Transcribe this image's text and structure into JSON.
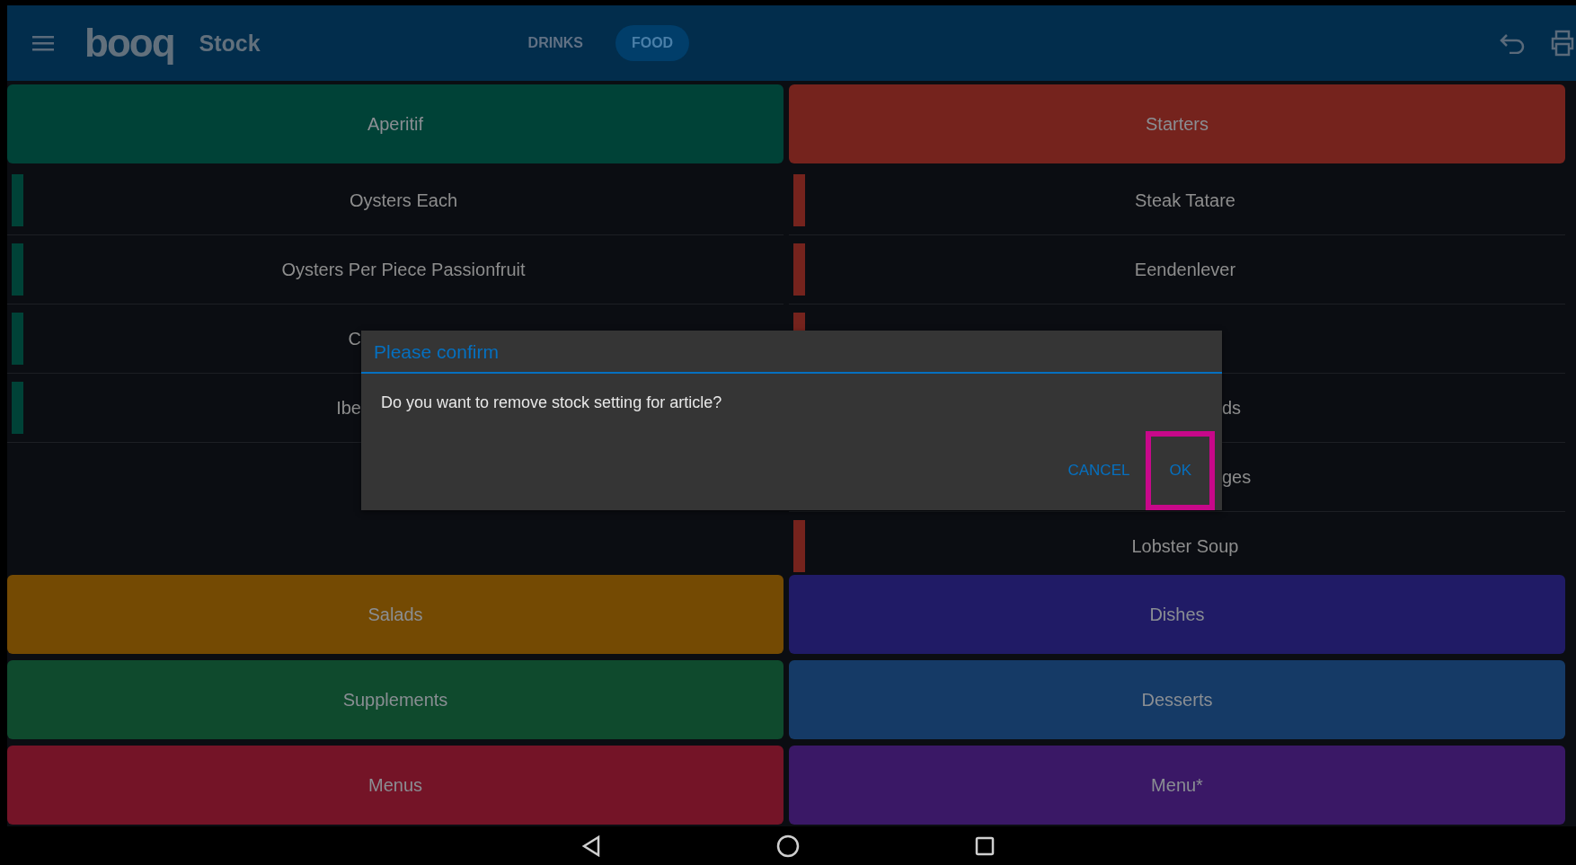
{
  "app_bar": {
    "logo": "booq",
    "title": "Stock",
    "tabs": [
      {
        "label": "DRINKS",
        "selected": false
      },
      {
        "label": "FOOD",
        "selected": true
      }
    ]
  },
  "columns": [
    {
      "category": {
        "label": "Aperitif",
        "color": "#004237"
      },
      "items": [
        {
          "kind": "full",
          "name": "Oysters Each"
        },
        {
          "kind": "full",
          "name": "Oysters Per Piece Passionfruit"
        },
        {
          "kind": "cut_end",
          "name": "C"
        },
        {
          "kind": "cut_end",
          "name": "Ibe"
        }
      ]
    },
    {
      "category": {
        "label": "Starters",
        "color": "#75231d"
      },
      "items": [
        {
          "kind": "full",
          "name": "Steak Tatare"
        },
        {
          "kind": "full",
          "name": "Eendenlever"
        },
        {
          "kind": "covered"
        },
        {
          "kind": "cut_start",
          "name": "ds"
        },
        {
          "kind": "cut_start",
          "name": "ges"
        },
        {
          "kind": "full",
          "name": "Lobster Soup"
        }
      ]
    }
  ],
  "categories": [
    {
      "label": "Salads",
      "color": "#744a03"
    },
    {
      "label": "Dishes",
      "color": "#201b66"
    },
    {
      "label": "Supplements",
      "color": "#0f4a2d"
    },
    {
      "label": "Desserts",
      "color": "#153a66"
    },
    {
      "label": "Menus",
      "color": "#741427"
    },
    {
      "label": "Menu*",
      "color": "#3a1866"
    }
  ],
  "dialog": {
    "title": "Please confirm",
    "message": "Do you want to remove stock setting for article?",
    "buttons": [
      {
        "label": "CANCEL",
        "highlighted": false
      },
      {
        "label": "OK",
        "highlighted": true
      }
    ]
  }
}
